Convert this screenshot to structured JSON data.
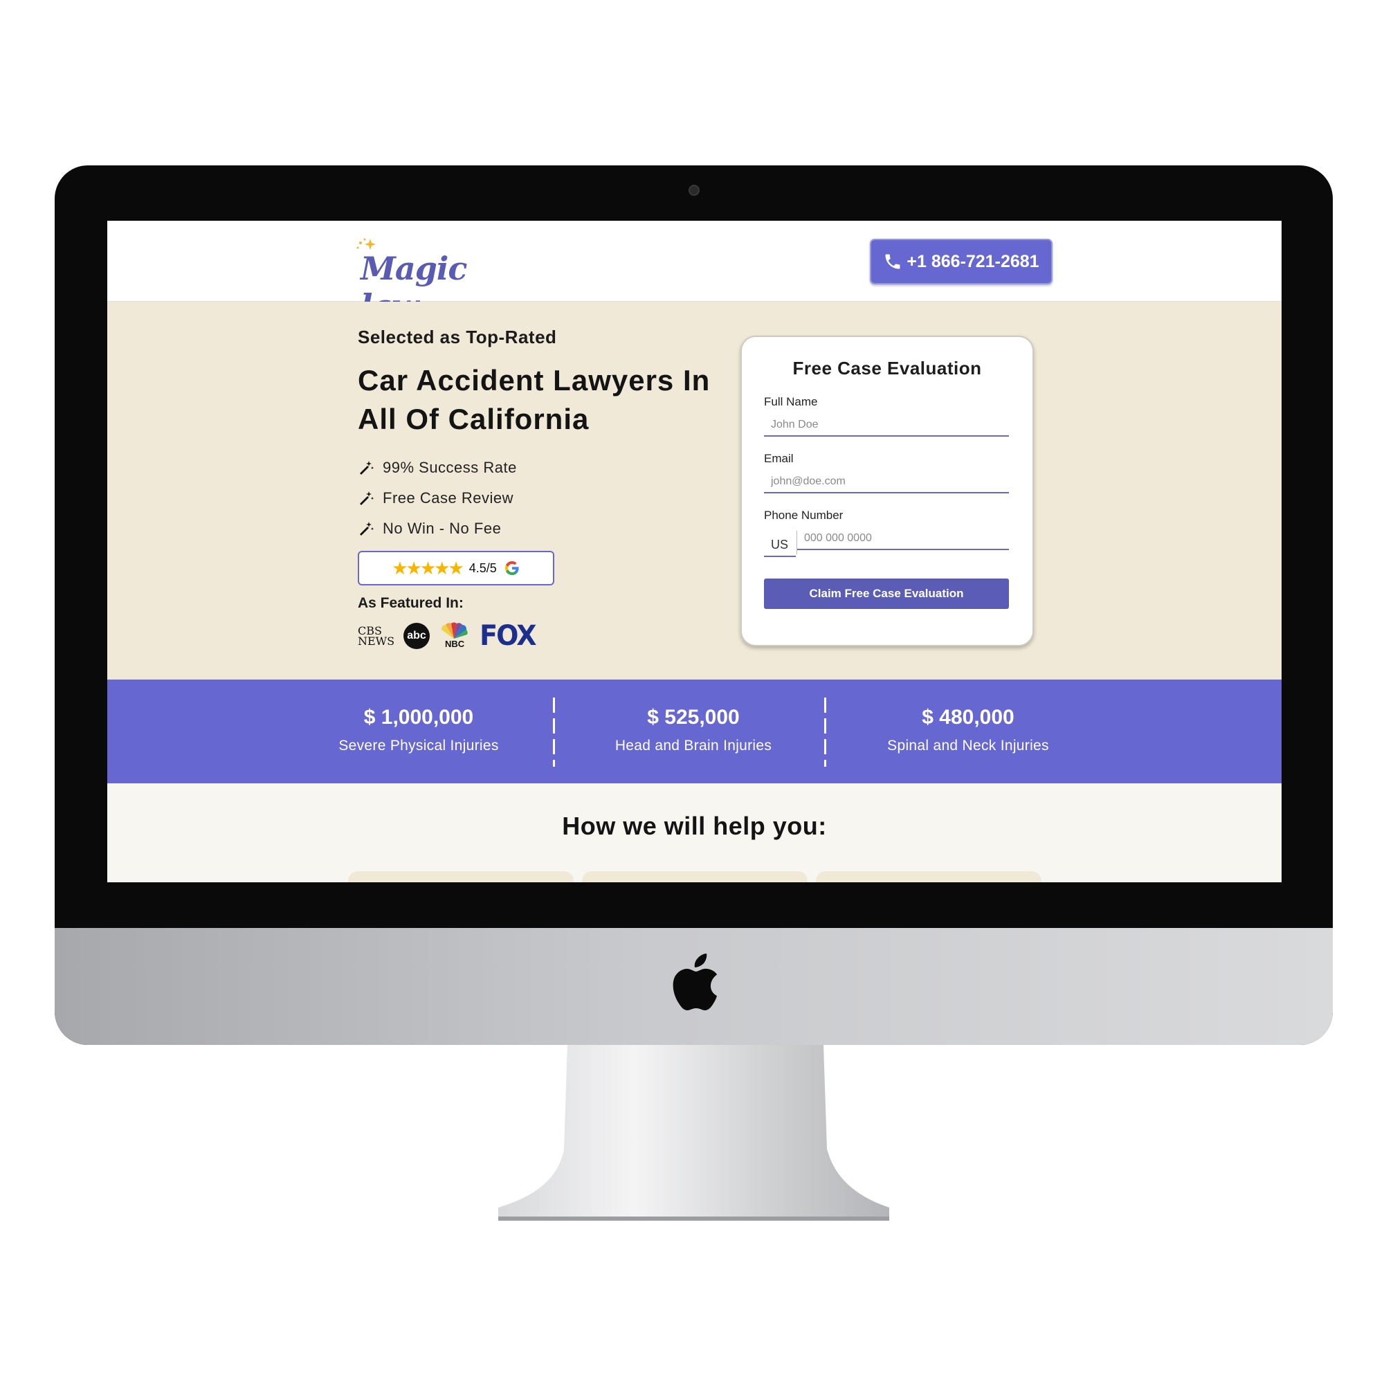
{
  "header": {
    "logo_text": "Magic law",
    "phone": "+1 866-721-2681"
  },
  "hero": {
    "eyebrow": "Selected as Top-Rated",
    "headline": "Car Accident Lawyers In All Of California",
    "features": [
      "99% Success Rate",
      "Free Case Review",
      "No Win - No Fee"
    ],
    "rating": {
      "stars": "★★★★★",
      "score": "4.5/5",
      "value": 4.5,
      "max": 5
    },
    "featured_label": "As Featured In:",
    "media": {
      "cbs": "CBS NEWS",
      "abc": "abc",
      "nbc": "NBC",
      "fox": "FOX"
    }
  },
  "form": {
    "title": "Free Case Evaluation",
    "name_label": "Full Name",
    "name_placeholder": "John Doe",
    "email_label": "Email",
    "email_placeholder": "john@doe.com",
    "phone_label": "Phone Number",
    "country": "US",
    "phone_placeholder": "000 000 0000",
    "submit": "Claim Free Case Evaluation"
  },
  "stats": [
    {
      "amount": "$ 1,000,000",
      "label": "Severe Physical Injuries"
    },
    {
      "amount": "$ 525,000",
      "label": "Head and Brain Injuries"
    },
    {
      "amount": "$ 480,000",
      "label": "Spinal and Neck Injuries"
    }
  ],
  "help_heading": "How we will help you:",
  "colors": {
    "accent": "#6667d0",
    "hero_bg": "#f0e9d7",
    "button": "#5b5cb5"
  }
}
